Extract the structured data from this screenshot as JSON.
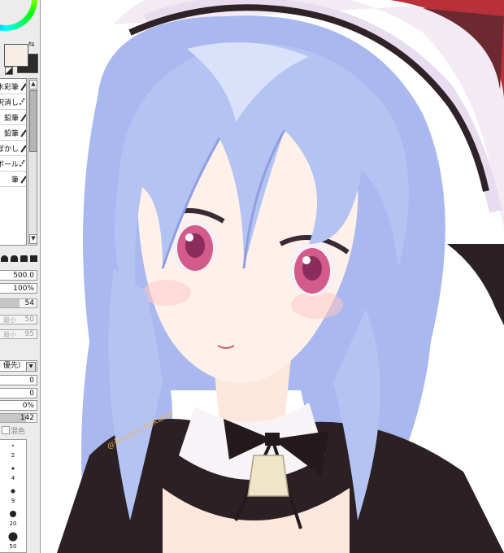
{
  "colors": {
    "foreground": "#f7efe6",
    "background": "#2b2b2b",
    "panel": "#ececec",
    "hair": "#b4c3f2",
    "hair_shadow": "#8e9ee0",
    "skin": "#fff1ea",
    "eye": "#e64d86",
    "ribbon": "#2a1f22",
    "signature": "#e8b65a"
  },
  "tools": {
    "items": [
      {
        "label": "水彩筆",
        "icon": "brush-icon"
      },
      {
        "label": "選択消し",
        "icon": "eraser-icon"
      },
      {
        "label": "鉛筆",
        "icon": "pencil-icon"
      },
      {
        "label": "鉛筆",
        "icon": "pencil-icon"
      },
      {
        "label": "ぼかし",
        "icon": "blur-icon"
      },
      {
        "label": "ボール",
        "icon": "ballpen-icon"
      },
      {
        "label": "筆",
        "icon": "brush-icon"
      }
    ]
  },
  "brush": {
    "size": "500.0",
    "size_scale": "100%",
    "density": "54",
    "density_fill": 0.54,
    "min_size_label": "最小",
    "min_size": "50",
    "min_density_label": "最小",
    "min_density": "95",
    "mode": "優先）",
    "val_a": "0",
    "val_b": "0",
    "val_c": "0%",
    "val_d": "142",
    "val_d_fill": 0.71,
    "mix_label": "混色"
  },
  "dots": [
    "·",
    "2",
    "·",
    "4",
    "·",
    "9",
    "·",
    "20",
    "·",
    "50"
  ],
  "canvas": {
    "signature": "@hanaru_hakusai"
  }
}
